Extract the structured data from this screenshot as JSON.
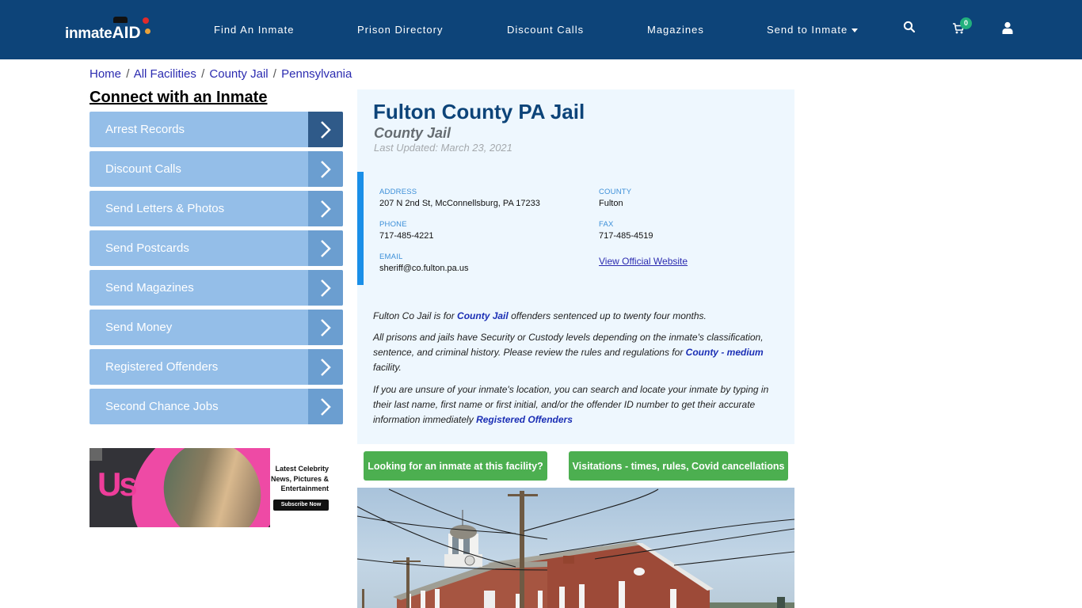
{
  "header": {
    "logo_text": "inmate",
    "logo_suffix": "AID",
    "nav": [
      {
        "label": "Find An Inmate"
      },
      {
        "label": "Prison Directory"
      },
      {
        "label": "Discount Calls"
      },
      {
        "label": "Magazines"
      },
      {
        "label": "Send to Inmate",
        "has_dropdown": true
      }
    ],
    "icons": [
      "search-icon",
      "cart-icon",
      "user-icon"
    ],
    "cart_count": "0"
  },
  "breadcrumb": [
    {
      "label": "Home"
    },
    {
      "label": "All Facilities"
    },
    {
      "label": "County Jail"
    },
    {
      "label": "Pennsylvania"
    }
  ],
  "breadcrumb_separator": "/",
  "sidebar": {
    "title": "Connect with an Inmate",
    "items": [
      {
        "label": "Arrest Records",
        "active": true
      },
      {
        "label": "Discount Calls"
      },
      {
        "label": "Send Letters & Photos"
      },
      {
        "label": "Send Postcards"
      },
      {
        "label": "Send Magazines"
      },
      {
        "label": "Send Money"
      },
      {
        "label": "Registered Offenders"
      },
      {
        "label": "Second Chance Jobs"
      }
    ],
    "ad": {
      "brand": "Us",
      "tagline_lines": [
        "Latest Celebrity",
        "News, Pictures &",
        "Entertainment"
      ],
      "cta": "Subscribe Now"
    }
  },
  "facility": {
    "name": "Fulton County PA Jail",
    "type": "County Jail",
    "last_updated": "Last Updated: March 23, 2021",
    "fields": {
      "address_label": "ADDRESS",
      "address": "207 N 2nd St, McConnellsburg, PA 17233",
      "county_label": "COUNTY",
      "county": "Fulton",
      "phone_label": "PHONE",
      "phone": "717-485-4221",
      "fax_label": "FAX",
      "fax": "717-485-4519",
      "email_label": "EMAIL",
      "email": "sheriff@co.fulton.pa.us",
      "website_link": "View Official Website"
    },
    "description": {
      "p1_before": "Fulton Co Jail is for ",
      "p1_link": "County Jail",
      "p1_after": " offenders sentenced up to twenty four months.",
      "p2_before": "All prisons and jails have Security or Custody levels depending on the inmate's classification, sentence, and criminal history. Please review the rules and regulations for ",
      "p2_link": "County - medium",
      "p2_after": " facility.",
      "p3_before": "If you are unsure of your inmate's location, you can search and locate your inmate by typing in their last name, first name or first initial, and/or the offender ID number to get their accurate information immediately ",
      "p3_link": "Registered Offenders"
    },
    "buttons": {
      "looking": "Looking for an inmate at this facility?",
      "visitations": "Visitations - times, rules, Covid cancellations"
    }
  },
  "colors": {
    "navbar": "#0d4479",
    "sidebar_item": "#94bee8",
    "sidebar_arrow": "#6b9ed0",
    "sidebar_arrow_active": "#2f5a89",
    "panel_bg": "#eef7fe",
    "accent_bar": "#1a8fe8",
    "green_button": "#4caf50",
    "link": "#2b2bb0"
  }
}
